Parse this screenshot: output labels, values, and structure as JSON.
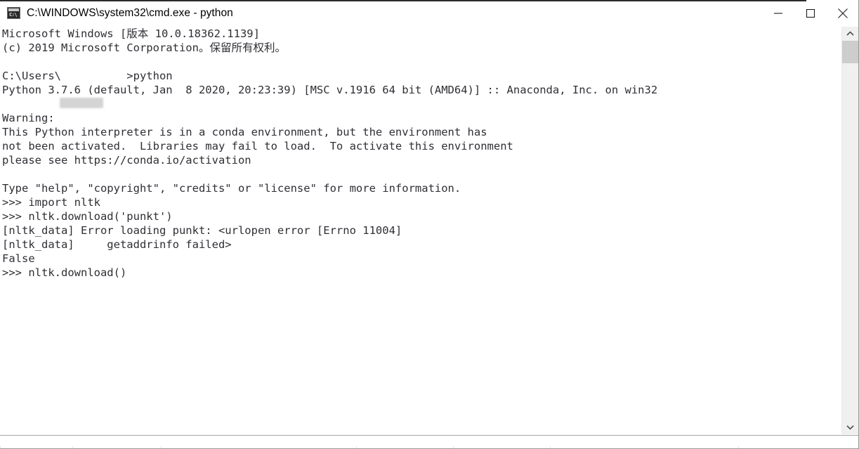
{
  "window": {
    "title": "C:\\WINDOWS\\system32\\cmd.exe - python",
    "icon_name": "cmd-icon",
    "icon_glyph": "C:\\",
    "bg_color": "#ffffff",
    "text_color": "#2f2f35",
    "accent_blue": "#21a1f1"
  },
  "controls": {
    "minimize_label": "Minimize",
    "maximize_label": "Maximize",
    "close_label": "Close"
  },
  "scrollbar": {
    "up_label": "Scroll up",
    "down_label": "Scroll down",
    "thumb_label": "Scroll thumb",
    "thumb_color": "#cdcdcd",
    "track_color": "#f0f0f0"
  },
  "console": {
    "lines": [
      "Microsoft Windows [版本 10.0.18362.1139]",
      "(c) 2019 Microsoft Corporation。保留所有权利。",
      "",
      "C:\\Users\\          >python",
      "Python 3.7.6 (default, Jan  8 2020, 20:23:39) [MSC v.1916 64 bit (AMD64)] :: Anaconda, Inc. on win32",
      "",
      "Warning:",
      "This Python interpreter is in a conda environment, but the environment has",
      "not been activated.  Libraries may fail to load.  To activate this environment",
      "please see https://conda.io/activation",
      "",
      "Type \"help\", \"copyright\", \"credits\" or \"license\" for more information.",
      ">>> import nltk",
      ">>> nltk.download('punkt')",
      "[nltk_data] Error loading punkt: <urlopen error [Errno 11004]",
      "[nltk_data]     getaddrinfo failed>",
      "False",
      ">>> nltk.download()"
    ],
    "redaction_note": "username-redacted"
  }
}
